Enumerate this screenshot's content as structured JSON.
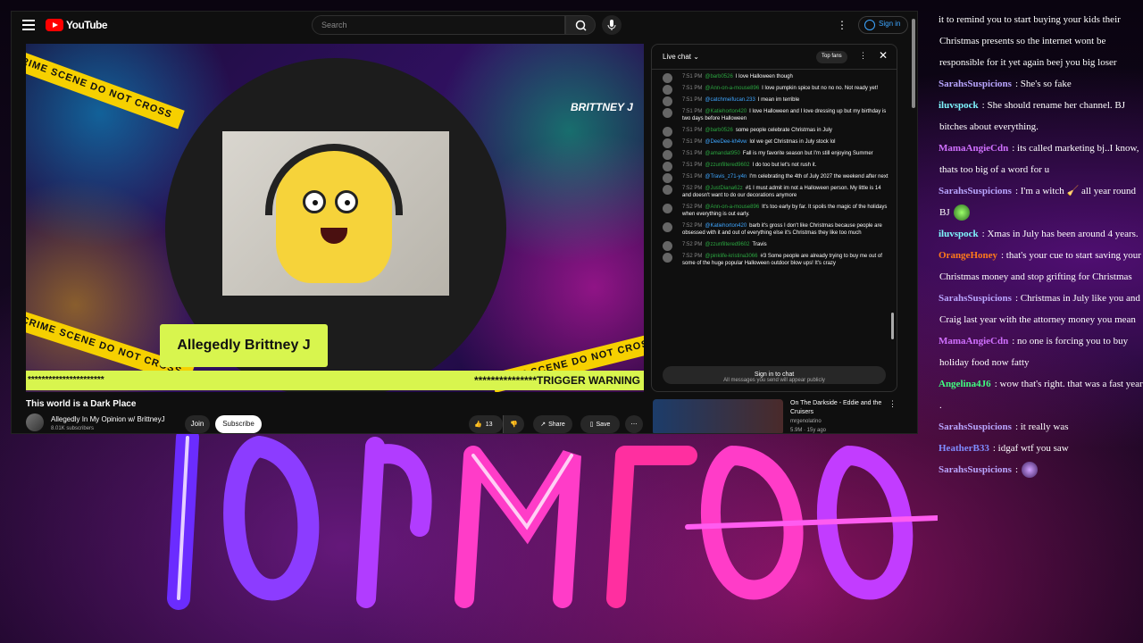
{
  "youtube": {
    "logo_text": "YouTube",
    "search_placeholder": "Search",
    "sign_in": "Sign in",
    "video": {
      "top_tape": "CRIME SCENE DO NOT CROSS",
      "brittney_tag": "BRITTNEY J",
      "name_card": "Allegedly Brittney J",
      "strip_left": "**********************",
      "strip_right": "***************TRIGGER WARNING"
    },
    "title": "This world is a Dark Place",
    "channel": {
      "name": "Allegedly In My Opinion w/ BrittneyJ",
      "subs": "8.01K subscribers"
    },
    "join": "Join",
    "subscribe": "Subscribe",
    "likes": "13",
    "share": "Share",
    "save": "Save",
    "chat": {
      "header": "Live chat",
      "top_fans": "Top fans",
      "messages": [
        {
          "time": "7:51 PM",
          "author": "@barb0526",
          "text": "I love Halloween though"
        },
        {
          "time": "7:51 PM",
          "author": "@Ann-on-a-mouse896",
          "text": "I love pumpkin spice but no no no. Not ready yet!"
        },
        {
          "time": "7:51 PM",
          "author": "@catchmeifucan.233",
          "text": "I mean im terrible"
        },
        {
          "time": "7:51 PM",
          "author": "@Katiehorton420",
          "text": "I love Halloween and I love dressing up but my birthday is two days before Halloween"
        },
        {
          "time": "7:51 PM",
          "author": "@barb0526",
          "text": "some people celebrate Christmas in July"
        },
        {
          "time": "7:51 PM",
          "author": "@DeeDee-kh4vw",
          "text": "lol we get Christmas in July stock lol"
        },
        {
          "time": "7:51 PM",
          "author": "@amandat950",
          "text": "Fall is my favorite season but I'm still enjoying Summer"
        },
        {
          "time": "7:51 PM",
          "author": "@zzunfiltered9602",
          "text": "I do too but let's not rush it."
        },
        {
          "time": "7:51 PM",
          "author": "@Travis_z71-y4n",
          "text": "I'm celebrating the 4th of July 2027 the weekend after next"
        },
        {
          "time": "7:52 PM",
          "author": "@JustDiana62z",
          "text": "#1 I must admit im not a Halloween person. My little is 14 and doesn't want to do our decorations anymore"
        },
        {
          "time": "7:52 PM",
          "author": "@Ann-on-a-mouse896",
          "text": "It's too early by far. It spoils the magic of the holidays when everything is out early."
        },
        {
          "time": "7:52 PM",
          "author": "@Katiehorton420",
          "text": "barb it's gross I don't like Christmas because people are obsessed with it and out of everything else it's Christmas they like too much"
        },
        {
          "time": "7:52 PM",
          "author": "@zzunfiltered9602",
          "text": "Travis"
        },
        {
          "time": "7:52 PM",
          "author": "@pinklife-kristina3066",
          "text": "#3 Some people are already trying to buy me out of some of the huge popular Halloween outdoor blow ups! It's crazy"
        }
      ],
      "sign_in_chat": "Sign in to chat",
      "note": "All messages you send will appear publicly"
    },
    "rec": {
      "title": "On The Darkside - Eddie and the Cruisers",
      "channel": "mrgenolatino",
      "meta": "5.9M · 15y ago"
    }
  },
  "overlay_chat": [
    {
      "user": "",
      "text": "it to remind you to start buying your kids their Christmas presents so the internet wont be responsible for it yet again beej you big loser",
      "color": "#ffffff"
    },
    {
      "user": "SarahsSuspicions",
      "text": ": She's so fake",
      "color": "#b9a6ff"
    },
    {
      "user": "iluvspock",
      "text": ": She should rename her channel. BJ bitches about everything.",
      "color": "#7ff7ff"
    },
    {
      "user": "MamaAngieCdn",
      "text": ": its called marketing bj..I know, thats too big of a word for u",
      "color": "#d070ff"
    },
    {
      "user": "SarahsSuspicions",
      "text": ": I'm a witch 🧹 all year round BJ",
      "color": "#b9a6ff"
    },
    {
      "user": "iluvspock",
      "text": ": Xmas in July has been around 4 years.",
      "color": "#7ff7ff"
    },
    {
      "user": "OrangeHoney",
      "text": ": that's your cue to start saving your Christmas money and stop grifting for Christmas",
      "color": "#ff7a1a"
    },
    {
      "user": "SarahsSuspicions",
      "text": ": Christmas in July like you and Craig last year with the attorney money you mean",
      "color": "#b9a6ff"
    },
    {
      "user": "MamaAngieCdn",
      "text": ": no one is forcing you to buy holiday food now fatty",
      "color": "#d070ff"
    },
    {
      "user": "Angelina4J6",
      "text": ": wow that's right. that was a fast year .",
      "color": "#40ff80"
    },
    {
      "user": "SarahsSuspicions",
      "text": ": it really was",
      "color": "#b9a6ff"
    },
    {
      "user": "HeatherB33",
      "text": ": idgaf wtf you saw",
      "color": "#7f8cff"
    },
    {
      "user": "SarahsSuspicions",
      "text": ":",
      "color": "#b9a6ff"
    }
  ]
}
